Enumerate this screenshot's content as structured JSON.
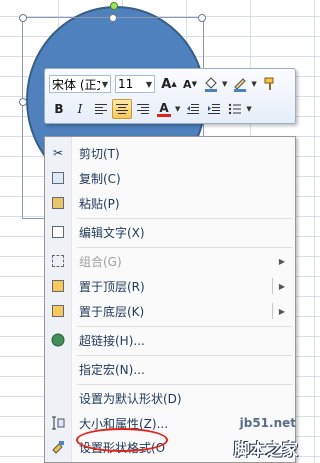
{
  "mini_toolbar": {
    "font_name": "宋体 (正文",
    "font_size": "11",
    "grow_font": "A",
    "shrink_font": "A",
    "bold": "B",
    "italic": "I",
    "font_color_letter": "A"
  },
  "context_menu": {
    "items": [
      {
        "label": "剪切(T)",
        "icon": "scissors-icon",
        "enabled": true
      },
      {
        "label": "复制(C)",
        "icon": "copy-icon",
        "enabled": true
      },
      {
        "label": "粘贴(P)",
        "icon": "paste-icon",
        "enabled": true
      },
      {
        "label": "编辑文字(X)",
        "icon": "edit-text-icon",
        "enabled": true
      },
      {
        "label": "组合(G)",
        "icon": "group-icon",
        "enabled": false
      },
      {
        "label": "置于顶层(R)",
        "icon": "bring-to-front-icon",
        "enabled": true
      },
      {
        "label": "置于底层(K)",
        "icon": "send-to-back-icon",
        "enabled": true
      },
      {
        "label": "超链接(H)...",
        "icon": "hyperlink-icon",
        "enabled": true
      },
      {
        "label": "指定宏(N)...",
        "icon": "",
        "enabled": true
      },
      {
        "label": "设置为默认形状(D)",
        "icon": "",
        "enabled": true
      },
      {
        "label": "大小和属性(Z)...",
        "icon": "size-properties-icon",
        "enabled": true
      },
      {
        "label": "设置形状格式(O",
        "icon": "format-shape-icon",
        "enabled": true
      }
    ]
  },
  "watermark": {
    "site": "jb51.net",
    "brand": "脚本之家"
  },
  "colors": {
    "shape_fill": "#4f81bd",
    "highlight": "#e2231a"
  }
}
